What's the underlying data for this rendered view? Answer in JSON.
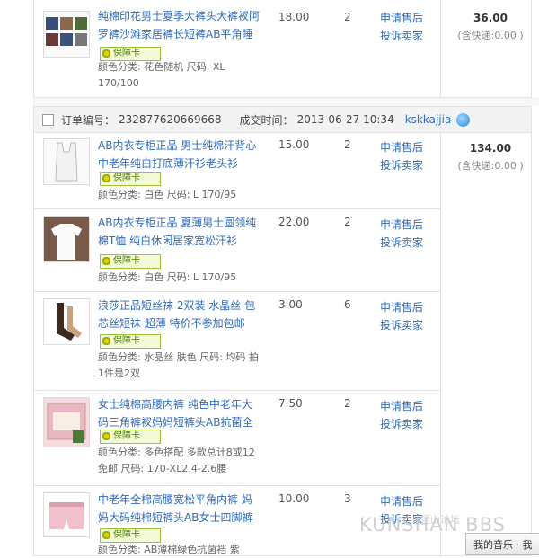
{
  "top_item": {
    "title": "纯棉印花男士夏季大裤头大裤衩阿罗裤沙滩家居裤长短裤AB平角睡",
    "badge": "保障卡",
    "attrs": "颜色分类: 花色随机 尺码: XL 170/100",
    "price": "18.00",
    "qty": "2",
    "svc1": "申请售后",
    "svc2": "投诉卖家",
    "total": "36.00",
    "ship": "(含快递:0.00 )"
  },
  "order": {
    "order_label": "订单编号：",
    "order_no": "232877620669668",
    "time_label": "成交时间：",
    "time": "2013-06-27 10:34",
    "seller": "kskkajjia",
    "total": "134.00",
    "ship": "(含快递:0.00 )",
    "items": [
      {
        "title": "AB内衣专柜正品 男士纯棉汗背心中老年纯白打底薄汗衫老头衫",
        "badge": "保障卡",
        "attrs": "颜色分类: 白色 尺码: L 170/95",
        "price": "15.00",
        "qty": "2",
        "svc1": "申请售后",
        "svc2": "投诉卖家"
      },
      {
        "title": "AB内衣专柜正品 夏薄男士圆领纯棉T恤 纯白休闲居家宽松汗衫",
        "badge": "保障卡",
        "attrs": "颜色分类: 白色 尺码: L 170/95",
        "price": "22.00",
        "qty": "2",
        "svc1": "申请售后",
        "svc2": "投诉卖家"
      },
      {
        "title": "浪莎正品短丝袜 2双装 水晶丝 包芯丝短袜 超薄 特价不参加包邮",
        "badge": "保障卡",
        "attrs": "颜色分类: 水晶丝 肤色 尺码: 均码 拍1件是2双",
        "price": "3.00",
        "qty": "6",
        "svc1": "申请售后",
        "svc2": "投诉卖家"
      },
      {
        "title": "女士纯棉高腰内裤 纯色中老年大码三角裤衩妈妈短裤头AB抗菌全",
        "badge": "保障卡",
        "attrs": "颜色分类: 多色搭配 多款总计8或12免邮 尺码: 170-XL2.4-2.6腰",
        "price": "7.50",
        "qty": "2",
        "svc1": "申请售后",
        "svc2": "投诉卖家"
      },
      {
        "title": "中老年全棉高腰宽松平角内裤 妈妈大码纯棉短裤头AB女士四脚裤",
        "badge": "保障卡",
        "attrs": "颜色分类: AB薄棉绿色抗菌裆 紫",
        "price": "10.00",
        "qty": "3",
        "svc1": "申请售后",
        "svc2": "投诉卖家"
      }
    ]
  },
  "watermark": "KUNSHAN BBS",
  "watermark_small": "昆山论坛",
  "bottom_button": "我的音乐 · 我"
}
